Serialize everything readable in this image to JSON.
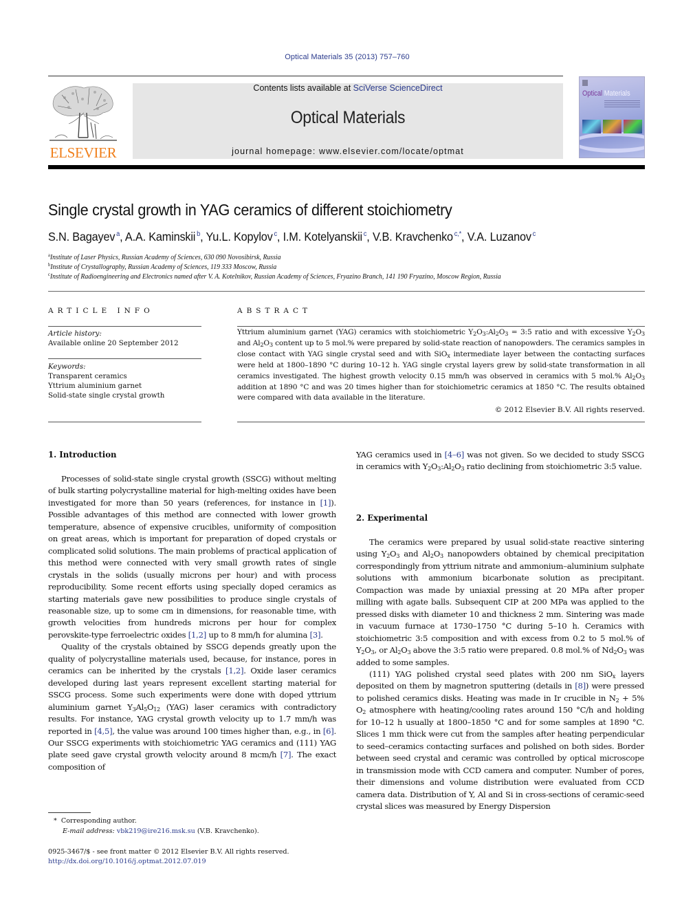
{
  "header": {
    "journal_ref": "Optical Materials 35 (2013) 757–760",
    "contents_prefix": "Contents lists available at ",
    "contents_link": "SciVerse ScienceDirect",
    "journal_name": "Optical Materials",
    "homepage": "journal homepage: www.elsevier.com/locate/optmat",
    "publisher_logo_text": "ELSEVIER",
    "cover_title_a": "Optical",
    "cover_title_b": "Materials",
    "colors": {
      "link": "#2a3a8c",
      "elsevier_orange": "#f07f1b",
      "masthead_bg": "#e6e6e6"
    }
  },
  "article": {
    "title": "Single crystal growth in YAG ceramics of different stoichiometry",
    "authors": [
      {
        "name": "S.N. Bagayev",
        "sup": "a",
        "sep": ", "
      },
      {
        "name": "A.A. Kaminskii",
        "sup": "b",
        "sep": ", "
      },
      {
        "name": "Yu.L. Kopylov",
        "sup": "c",
        "sep": ", "
      },
      {
        "name": "I.M. Kotelyanskii",
        "sup": "c",
        "sep": ", "
      },
      {
        "name": "V.B. Kravchenko",
        "sup": "c,*",
        "sep": ", "
      },
      {
        "name": "V.A. Luzanov",
        "sup": "c",
        "sep": ""
      }
    ],
    "affiliations": [
      {
        "key": "a",
        "text": "Institute of Laser Physics, Russian Academy of Sciences, 630 090 Novosibirsk, Russia"
      },
      {
        "key": "b",
        "text": "Institute of Crystallography, Russian Academy of Sciences, 119 333 Moscow, Russia"
      },
      {
        "key": "c",
        "text": "Institute of Radioengineering and Electronics named after V. A. Kotelnikov, Russian Academy of Sciences, Fryazino Branch, 141 190 Fryazino, Moscow Region, Russia"
      }
    ]
  },
  "article_info": {
    "heading": "ARTICLE INFO",
    "history_label": "Article history:",
    "history_value": "Available online 20 September 2012",
    "keywords_label": "Keywords:",
    "keywords": [
      "Transparent ceramics",
      "Yttrium aluminium garnet",
      "Solid-state single crystal growth"
    ]
  },
  "abstract": {
    "heading": "ABSTRACT",
    "copyright": "© 2012 Elsevier B.V. All rights reserved."
  },
  "sections": {
    "intro_title": "1. Introduction",
    "experimental_title": "2. Experimental"
  },
  "footnotes": {
    "corresponding_marker": "*",
    "corresponding_label": "Corresponding author.",
    "email_label": "E-mail address:",
    "email": "vbk219@ire216.msk.su",
    "email_owner": "(V.B. Kravchenko).",
    "issn_line": "0925-3467/$ - see front matter © 2012 Elsevier B.V. All rights reserved.",
    "doi": "http://dx.doi.org/10.1016/j.optmat.2012.07.019"
  }
}
